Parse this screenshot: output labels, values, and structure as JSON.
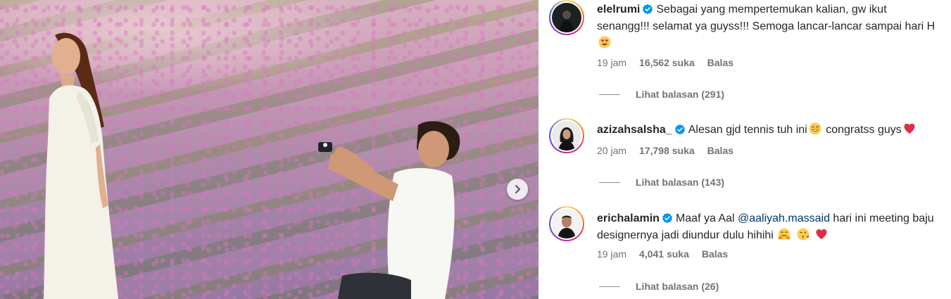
{
  "post": {
    "photo_alt": "photo",
    "next_icon": "chevron-right-icon"
  },
  "comments": [
    {
      "username": "elelrumi",
      "verified": true,
      "text_before": "Sebagai yang mempertemukan kalian, gw ikut senangg!!! selamat ya guyss!!! Semoga lancar-lancar sampai hari H",
      "emoji": [
        "heart-eyes"
      ],
      "time": "19 jam",
      "likes": "16,562 suka",
      "reply": "Balas",
      "view_replies": "Lihat balasan (291)"
    },
    {
      "username": "azizahsalsha_",
      "verified": true,
      "text_before": "Alesan gjd tennis tuh ini",
      "text_after": "congratss guys",
      "emoji": [
        "grin-sweat",
        "red-heart"
      ],
      "time": "20 jam",
      "likes": "17,798 suka",
      "reply": "Balas",
      "view_replies": "Lihat balasan (143)"
    },
    {
      "username": "erichalamin",
      "verified": true,
      "text_before": "Maaf ya Aal",
      "mention": "@aaliyah.massaid",
      "text_after": "hari ini meeting baju designernya jadi diundur dulu hihihi",
      "emoji": [
        "hugging",
        "kissing-heart",
        "red-heart"
      ],
      "time": "19 jam",
      "likes": "4,041 suka",
      "reply": "Balas",
      "view_replies": "Lihat balasan (26)"
    }
  ],
  "colors": {
    "text": "#262626",
    "muted": "#737373",
    "mention": "#00376b",
    "verified": "#0095f6"
  }
}
